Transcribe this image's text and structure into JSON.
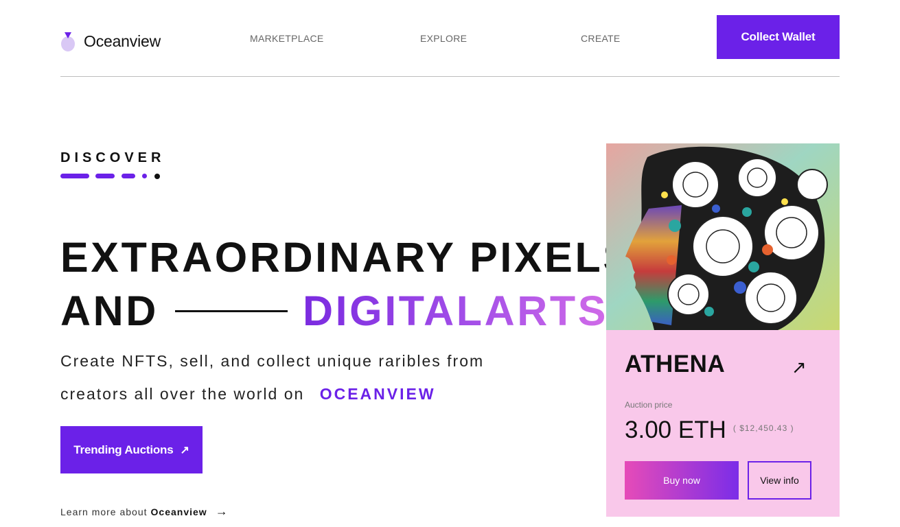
{
  "nav": {
    "brand": "Oceanview",
    "links": [
      "MARKETPLACE",
      "EXPLORE",
      "CREATE"
    ],
    "wallet_label": "Collect Wallet"
  },
  "hero": {
    "eyebrow": "DISCOVER",
    "headline_line1": "EXTRAORDINARY PIXELS",
    "headline_line2_left": "AND",
    "headline_line2_right": "DIGITALARTS",
    "sub_line1": "Create NFTS, sell, and collect unique raribles from",
    "sub_line2": "creators all over the world on",
    "sub_brand": "OCEANVIEW",
    "cta_label": "Trending Auctions",
    "learn_prefix": "Learn more about",
    "learn_brand": "Oceanview"
  },
  "card": {
    "title": "ATHENA",
    "price_label": "Auction price",
    "price": "3.00 ETH",
    "usd": "( $12,450.43 )",
    "buy_label": "Buy now",
    "info_label": "View info"
  },
  "colors": {
    "accent": "#6b21e8",
    "card_bg": "#f9c8ea",
    "gradient_start": "#e64bb8",
    "gradient_end": "#7b2de8"
  }
}
